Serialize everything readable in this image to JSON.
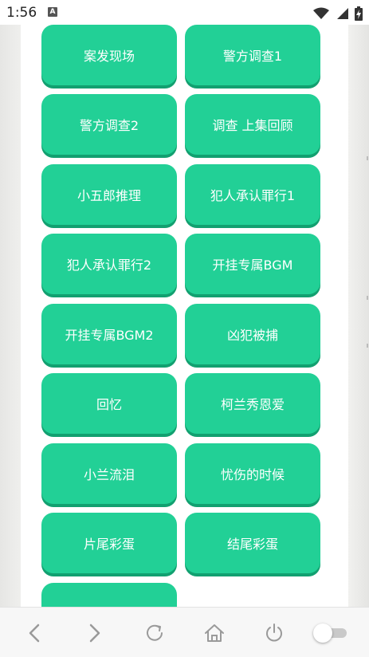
{
  "status_bar": {
    "time": "1:56",
    "notification_icon": "A"
  },
  "buttons": [
    {
      "label": "案发现场"
    },
    {
      "label": "警方调查1"
    },
    {
      "label": "警方调查2"
    },
    {
      "label": "调查 上集回顾"
    },
    {
      "label": "小五郎推理"
    },
    {
      "label": "犯人承认罪行1"
    },
    {
      "label": "犯人承认罪行2"
    },
    {
      "label": "开挂专属BGM"
    },
    {
      "label": "开挂专属BGM2"
    },
    {
      "label": "凶犯被捕"
    },
    {
      "label": "回忆"
    },
    {
      "label": "柯兰秀恩爱"
    },
    {
      "label": "小兰流泪"
    },
    {
      "label": "忧伤的时候"
    },
    {
      "label": "片尾彩蛋"
    },
    {
      "label": "结尾彩蛋"
    },
    {
      "label": ""
    }
  ],
  "nav_bar": {
    "icons": [
      "back-icon",
      "forward-icon",
      "refresh-icon",
      "home-icon",
      "power-icon",
      "toggle-switch"
    ],
    "toggle_on": false
  },
  "colors": {
    "button": "#22d096",
    "button_shadow": "#12a070",
    "panel": "#ffffff",
    "background": "#e9e9e7"
  }
}
